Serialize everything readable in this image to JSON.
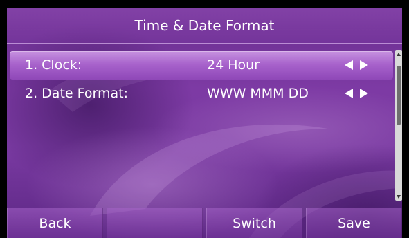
{
  "screen": {
    "title": "Time & Date Format"
  },
  "list": {
    "items": [
      {
        "label": "1. Clock:",
        "value": "24 Hour",
        "selected": true
      },
      {
        "label": "2. Date Format:",
        "value": "WWW MMM DD",
        "selected": false
      }
    ]
  },
  "softkeys": {
    "back": "Back",
    "empty": "",
    "switch": "Switch",
    "save": "Save"
  },
  "colors": {
    "background": "#7d3aa4",
    "selected_row": "#a863cc",
    "text": "#ffffff"
  },
  "icons": {
    "left": "arrow-left-icon",
    "right": "arrow-right-icon",
    "scroll_up": "scroll-up-icon",
    "scroll_down": "scroll-down-icon"
  }
}
